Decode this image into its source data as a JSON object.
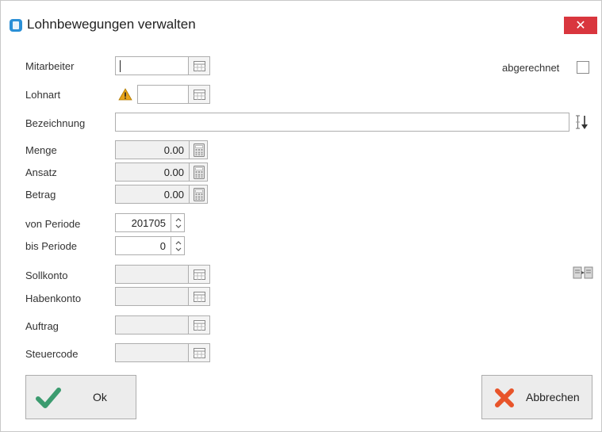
{
  "window": {
    "title": "Lohnbewegungen verwalten",
    "close_symbol": "✕"
  },
  "form": {
    "mitarbeiter": {
      "label": "Mitarbeiter",
      "value": ""
    },
    "abgerechnet": {
      "label": "abgerechnet",
      "checked": false
    },
    "lohnart": {
      "label": "Lohnart",
      "value": ""
    },
    "bezeichnung": {
      "label": "Bezeichnung",
      "value": ""
    },
    "menge": {
      "label": "Menge",
      "value": "0.00"
    },
    "ansatz": {
      "label": "Ansatz",
      "value": "0.00"
    },
    "betrag": {
      "label": "Betrag",
      "value": "0.00"
    },
    "von_periode": {
      "label": "von Periode",
      "value": "201705"
    },
    "bis_periode": {
      "label": "bis Periode",
      "value": "0"
    },
    "sollkonto": {
      "label": "Sollkonto",
      "value": ""
    },
    "habenkonto": {
      "label": "Habenkonto",
      "value": ""
    },
    "auftrag": {
      "label": "Auftrag",
      "value": ""
    },
    "steuercode": {
      "label": "Steuercode",
      "value": ""
    }
  },
  "buttons": {
    "ok": "Ok",
    "cancel": "Abbrechen"
  },
  "colors": {
    "close_bg": "#d9363e",
    "ok_check": "#3b9b6f",
    "cancel_x": "#e8542a",
    "warning": "#e8a317",
    "app_icon": "#2a8fd6"
  }
}
